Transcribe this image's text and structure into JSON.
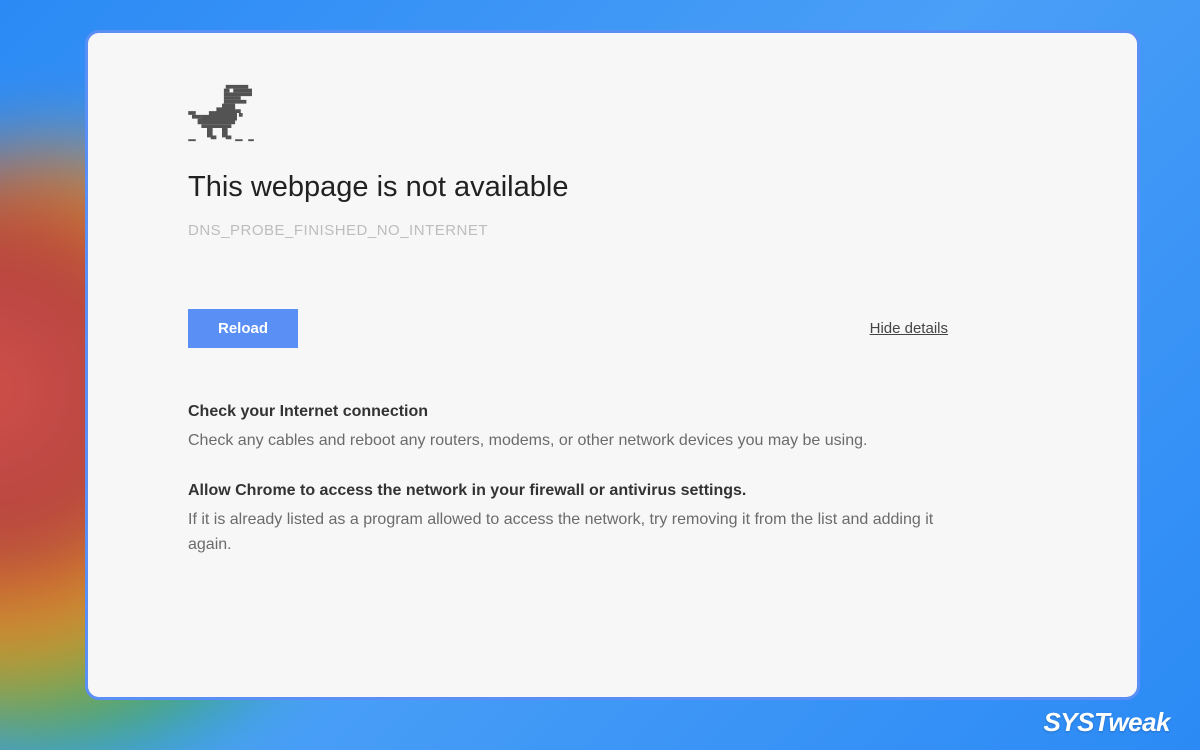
{
  "error": {
    "title": "This webpage is not available",
    "code": "DNS_PROBE_FINISHED_NO_INTERNET",
    "reload_label": "Reload",
    "hide_details_label": "Hide details"
  },
  "details": [
    {
      "heading": "Check your Internet connection",
      "body": "Check any cables and reboot any routers, modems, or other network devices you may be using."
    },
    {
      "heading": "Allow Chrome to access the network in your firewall or antivirus settings.",
      "body": "If it is already listed as a program allowed to access the network, try removing it from the list and adding it again."
    }
  ],
  "watermark": "SYSTweak",
  "icons": {
    "dino": "dinosaur-icon"
  },
  "colors": {
    "accent": "#5a8ff5",
    "panel_bg": "#f7f7f7",
    "muted": "#bdbdbd"
  }
}
